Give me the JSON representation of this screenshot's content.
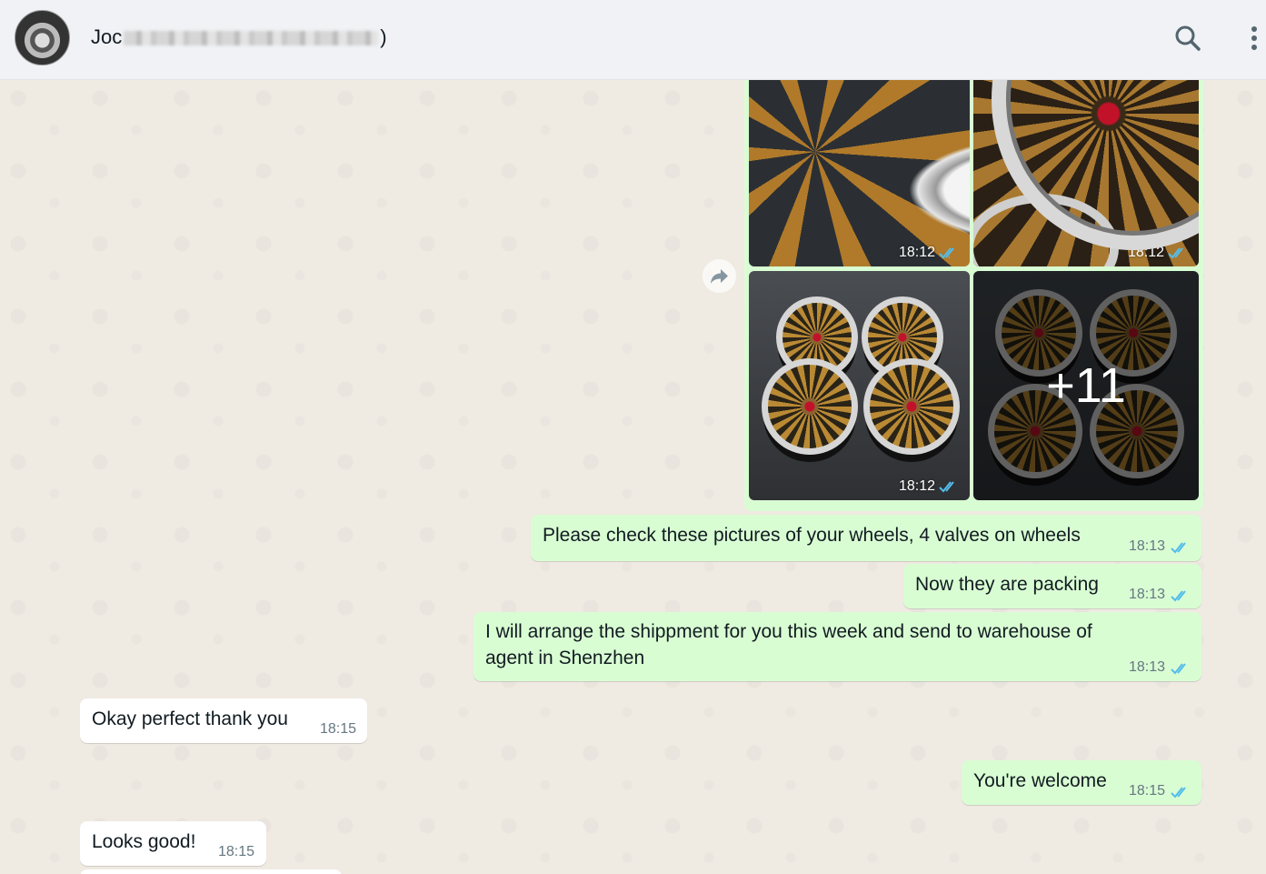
{
  "header": {
    "contact_name_start": "Joc",
    "contact_name_end": ")",
    "search_icon": "search-icon",
    "menu_icon": "more-vertical-icon"
  },
  "media": {
    "images": [
      {
        "time": "18:12",
        "status": "read"
      },
      {
        "time": "18:12",
        "status": "read"
      },
      {
        "time": "18:12",
        "status": "read"
      }
    ],
    "more_count": "+11",
    "forward_icon": "forward-icon"
  },
  "messages": [
    {
      "direction": "outgoing",
      "text": "Please check these pictures of your wheels, 4 valves on wheels",
      "time": "18:13",
      "status": "read"
    },
    {
      "direction": "outgoing",
      "text": "Now they are packing",
      "time": "18:13",
      "status": "read"
    },
    {
      "direction": "outgoing",
      "line1": "I will arrange the shippment for you this week and send to warehouse of",
      "line2": "agent in Shenzhen",
      "time": "18:13",
      "status": "read"
    },
    {
      "direction": "incoming",
      "text": "Okay perfect thank you",
      "time": "18:15"
    },
    {
      "direction": "outgoing",
      "text": "You're welcome",
      "time": "18:15",
      "status": "read"
    },
    {
      "direction": "incoming",
      "text": "Looks good!",
      "time": "18:15"
    }
  ],
  "colors": {
    "outgoing_bubble": "#d9fdd3",
    "incoming_bubble": "#ffffff",
    "read_tick": "#53bdeb",
    "chat_background": "#efeae2"
  }
}
